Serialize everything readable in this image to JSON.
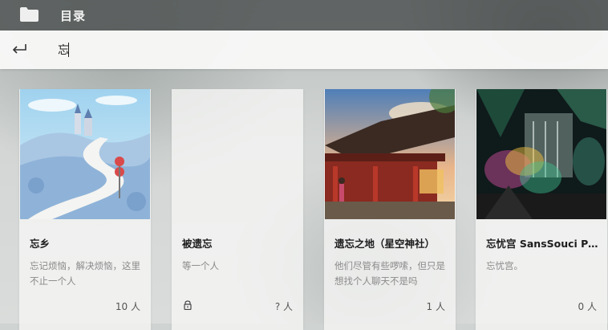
{
  "header": {
    "title": "目录",
    "folder_icon": "folder-icon"
  },
  "search": {
    "back_icon": "back-arrow-icon",
    "value": "忘",
    "placeholder": ""
  },
  "rooms": [
    {
      "title": "忘乡",
      "description": "忘记烦恼，解决烦恼，这里不止一个人",
      "count": "10 人",
      "locked": false,
      "thumb": "castle-road-illustration"
    },
    {
      "title": "被遗忘",
      "description": "等一个人",
      "count": "? 人",
      "locked": true,
      "thumb": ""
    },
    {
      "title": "遗忘之地（星空神社）",
      "description": "他们尽管有些啰嗦，但只是想找个人聊天不是吗",
      "count": "1 人",
      "locked": false,
      "thumb": "shrine-illustration"
    },
    {
      "title": "忘忧宫 SansSouci Palace",
      "description": "忘忧宫。",
      "count": "0 人",
      "locked": false,
      "thumb": "greenhouse-illustration"
    }
  ],
  "colors": {
    "topbar": "#464a4a",
    "searchbar": "#f8f8f7",
    "card": "#f6f6f5"
  }
}
